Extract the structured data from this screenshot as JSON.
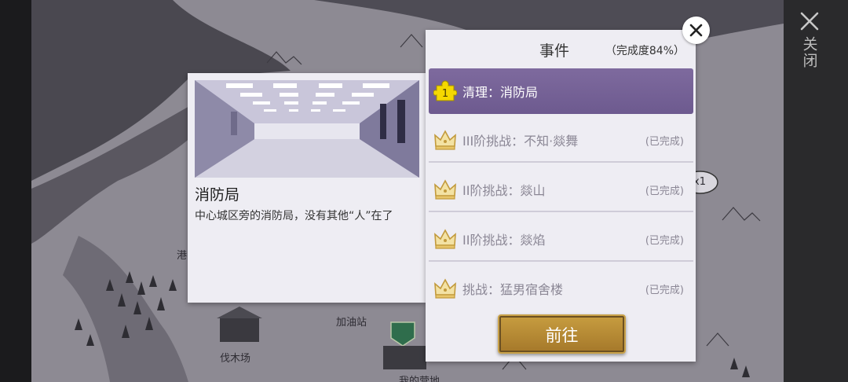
{
  "map": {
    "labels": [
      "港",
      "加油站",
      "伐木场",
      "我的营地",
      "x1"
    ]
  },
  "strip": {
    "close_label": "关闭"
  },
  "info_card": {
    "title": "消防局",
    "description": "中心城区旁的消防局，没有其他“人”在了"
  },
  "event_panel": {
    "title": "事件",
    "progress": "（完成度84%）",
    "items": [
      {
        "label": "清理：消防局",
        "status": "",
        "icon": "puzzle-icon",
        "badge": "1"
      },
      {
        "label": "III阶挑战：不知·燚舞",
        "status": "(已完成)",
        "icon": "crown-icon"
      },
      {
        "label": "II阶挑战：燚山",
        "status": "(已完成)",
        "icon": "crown-icon"
      },
      {
        "label": "II阶挑战：燚焰",
        "status": "(已完成)",
        "icon": "crown-icon"
      },
      {
        "label": "挑战：猛男宿舍楼",
        "status": "(已完成)",
        "icon": "crown-icon"
      }
    ],
    "go_label": "前往"
  },
  "colors": {
    "active_row": "#6d5a8f",
    "gold_button": "#b48732",
    "puzzle": "#f5d800"
  }
}
